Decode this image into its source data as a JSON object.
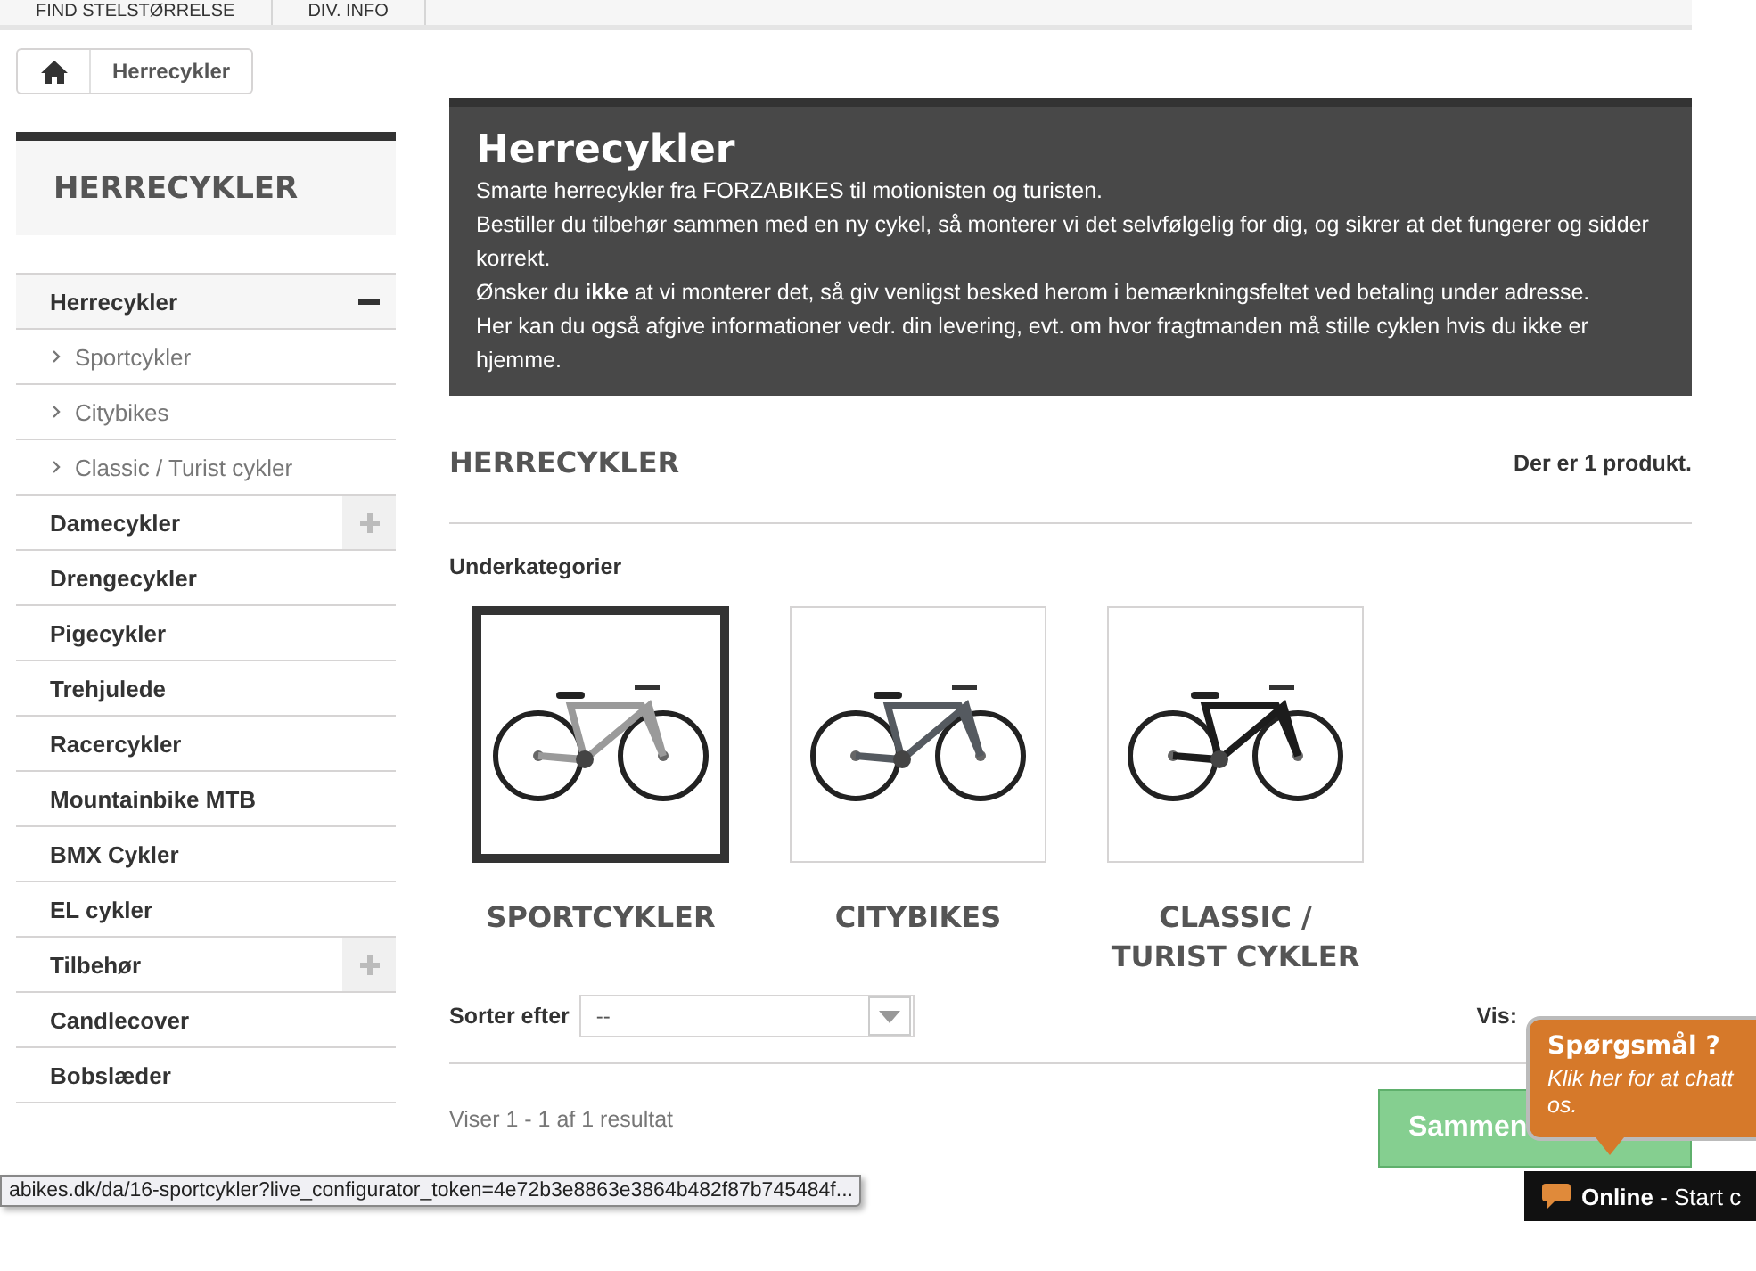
{
  "top_nav": [
    "FIND STELSTØRRELSE",
    "DIV. INFO"
  ],
  "breadcrumb": {
    "current": "Herrecykler"
  },
  "sidebar": {
    "title": "HERRECYKLER",
    "items": [
      {
        "label": "Herrecykler",
        "expanded": true,
        "children": [
          {
            "label": "Sportcykler"
          },
          {
            "label": "Citybikes"
          },
          {
            "label": "Classic / Turist cykler"
          }
        ]
      },
      {
        "label": "Damecykler",
        "expanded": false
      },
      {
        "label": "Drengecykler"
      },
      {
        "label": "Pigecykler"
      },
      {
        "label": "Trehjulede"
      },
      {
        "label": "Racercykler"
      },
      {
        "label": "Mountainbike MTB"
      },
      {
        "label": "BMX Cykler"
      },
      {
        "label": "EL cykler"
      },
      {
        "label": "Tilbehør",
        "expanded": false
      },
      {
        "label": "Candlecover"
      },
      {
        "label": "Bobslæder"
      }
    ]
  },
  "banner": {
    "title": "Herrecykler",
    "paragraphs": [
      "Smarte herrecykler fra FORZABIKES til motionisten og turisten.",
      "Bestiller du tilbehør sammen med en ny cykel, så monterer vi det selvfølgelig for dig, og sikrer at det fungerer og sidder korrekt.",
      "Ønsker du **ikke** at vi monterer det, så giv venligst besked herom i bemærkningsfeltet ved betaling under adresse.",
      "Her kan du også afgive informationer vedr. din levering, evt. om hvor fragtmanden må stille cyklen hvis du ikke er hjemme."
    ]
  },
  "category": {
    "heading": "HERRECYKLER",
    "count": "Der er 1 produkt.",
    "subcategories_label": "Underkategorier"
  },
  "subcategories": [
    {
      "label": "SPORTCYKLER",
      "selected": true
    },
    {
      "label": "CITYBIKES",
      "selected": false
    },
    {
      "label": "CLASSIC / TURIST CYKLER",
      "selected": false
    }
  ],
  "sort": {
    "label": "Sorter efter",
    "value": "--"
  },
  "view": {
    "label": "Vis:"
  },
  "results": "Viser 1 - 1 af 1 resultat",
  "compare_button": "Sammen",
  "chat": {
    "title": "Spørgsmål ?",
    "text": "Klik her for at chatt",
    "text_line_2": "os.",
    "status": "Online",
    "status_rest": " - Start c"
  },
  "status_url": "abikes.dk/da/16-sportcykler?live_configurator_token=4e72b3e8863e3864b482f87b745484f..."
}
